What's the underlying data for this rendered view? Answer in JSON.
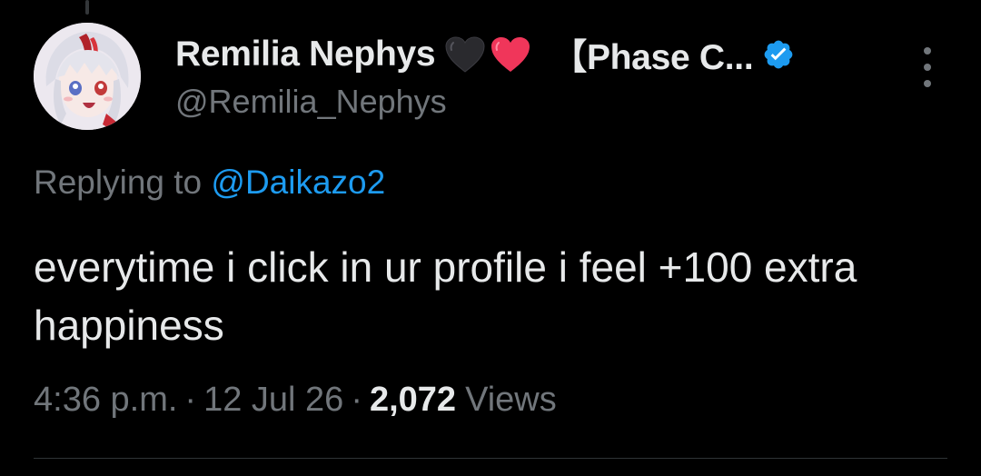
{
  "author": {
    "display_name": "Remilia Nephys",
    "name_suffix": "【Phase C...",
    "handle": "@Remilia_Nephys",
    "emoji": [
      "black-heart",
      "red-heart"
    ],
    "verified_color": "#1d9bf0"
  },
  "reply": {
    "prefix": "Replying to ",
    "mention": "@Daikazo2"
  },
  "tweet": {
    "text": "everytime i click in ur profile i feel +100 extra happiness"
  },
  "meta": {
    "time": "4:36 p.m.",
    "separator": "·",
    "date": "12 Jul 26",
    "views_count": "2,072",
    "views_label": "Views"
  },
  "colors": {
    "background": "#000000",
    "primary_text": "#e7e9ea",
    "secondary_text": "#71767b",
    "link": "#1d9bf0"
  },
  "icons": {
    "more": "more-vertical-icon",
    "verified": "verified-badge-icon"
  }
}
